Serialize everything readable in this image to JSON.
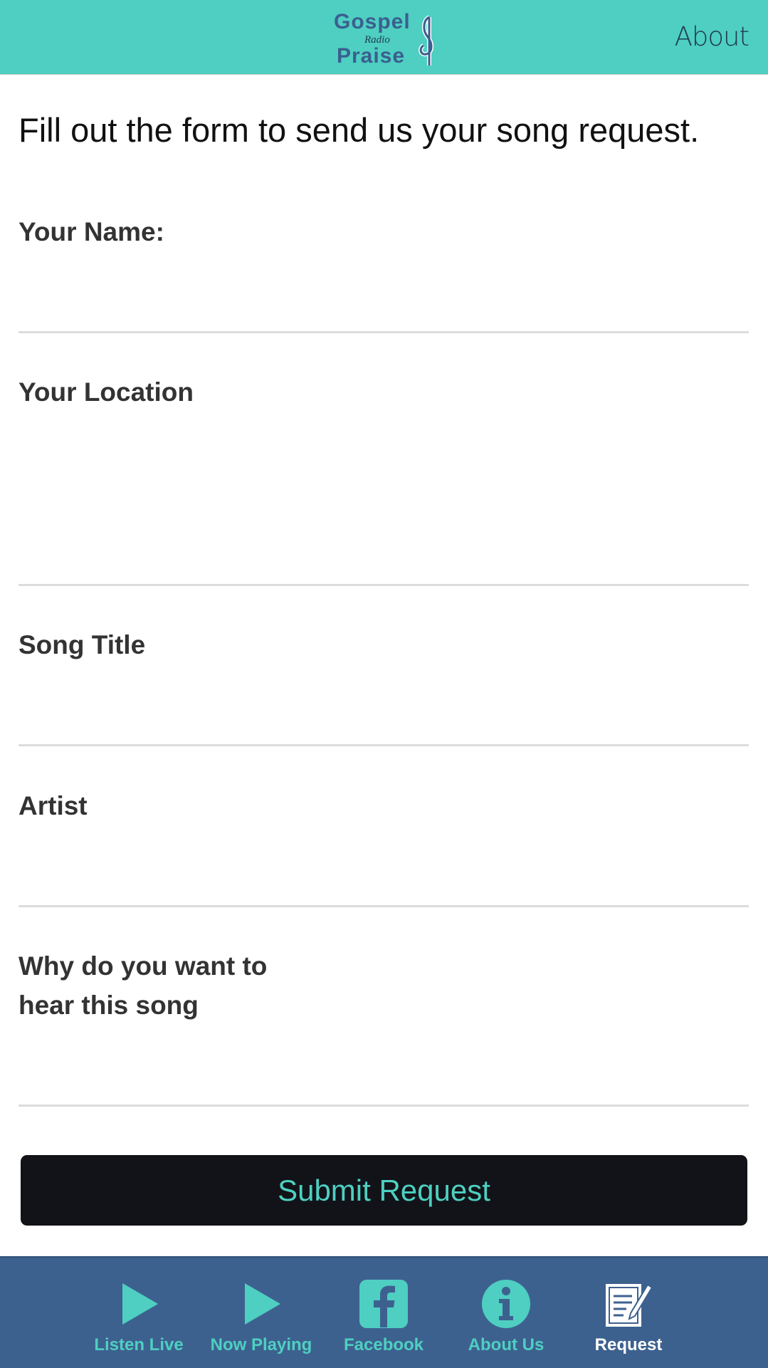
{
  "header": {
    "logo": {
      "line1": "Gospel",
      "line2": "Radio",
      "line3": "Praise"
    },
    "about_label": "About"
  },
  "intro": "Fill out the form to send us your song request.",
  "form": {
    "fields": [
      {
        "label": "Your Name:",
        "value": ""
      },
      {
        "label": "Your Location",
        "value": ""
      },
      {
        "label": "Song Title",
        "value": ""
      },
      {
        "label": "Artist",
        "value": ""
      },
      {
        "label_line1": "Why do you want to",
        "label_line2": "hear this song",
        "value": ""
      }
    ],
    "submit_label": "Submit Request"
  },
  "tabbar": {
    "items": [
      {
        "label": "Listen Live",
        "icon": "play-icon"
      },
      {
        "label": "Now Playing",
        "icon": "play-icon"
      },
      {
        "label": "Facebook",
        "icon": "facebook-icon"
      },
      {
        "label": "About Us",
        "icon": "info-icon"
      },
      {
        "label": "Request",
        "icon": "request-form-icon",
        "active": true
      }
    ]
  },
  "colors": {
    "accent": "#4ecfc1",
    "tabbar": "#3d618f",
    "button": "#111318",
    "logo_text": "#3a5f8f"
  }
}
